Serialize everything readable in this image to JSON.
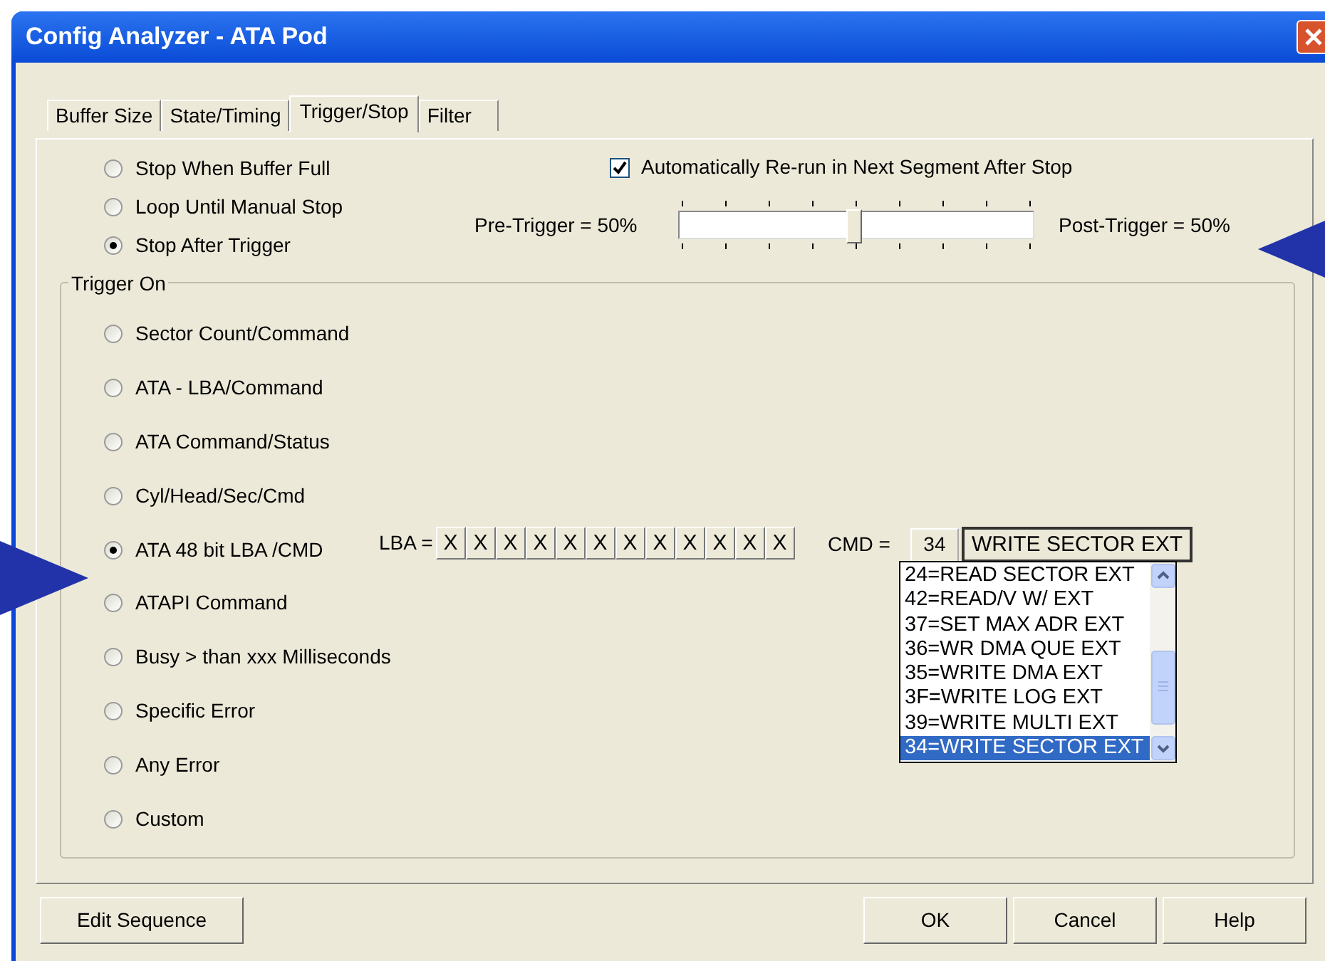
{
  "window": {
    "title": "Config Analyzer - ATA Pod"
  },
  "tabs": [
    {
      "label": "Buffer Size",
      "selected": false
    },
    {
      "label": "State/Timing",
      "selected": false
    },
    {
      "label": "Trigger/Stop",
      "selected": true
    },
    {
      "label": "Filter",
      "selected": false
    }
  ],
  "stop_modes": [
    {
      "label": "Stop When Buffer Full",
      "selected": false
    },
    {
      "label": "Loop Until Manual Stop",
      "selected": false
    },
    {
      "label": "Stop After Trigger",
      "selected": true
    }
  ],
  "auto_rerun": {
    "label": "Automatically Re-run in Next Segment After Stop",
    "checked": true
  },
  "trigger_slider": {
    "pre_label": "Pre-Trigger = 50%",
    "post_label": "Post-Trigger = 50%",
    "level": 0.5
  },
  "trigger_on": {
    "title": "Trigger On",
    "options": [
      {
        "label": "Sector Count/Command",
        "selected": false
      },
      {
        "label": "ATA - LBA/Command",
        "selected": false
      },
      {
        "label": "ATA Command/Status",
        "selected": false
      },
      {
        "label": "Cyl/Head/Sec/Cmd",
        "selected": false
      },
      {
        "label": "ATA 48 bit LBA /CMD",
        "selected": true
      },
      {
        "label": "ATAPI Command",
        "selected": false
      },
      {
        "label": "Busy > than  xxx Milliseconds",
        "selected": false
      },
      {
        "label": "Specific Error",
        "selected": false
      },
      {
        "label": "Any Error",
        "selected": false
      },
      {
        "label": "Custom",
        "selected": false
      }
    ]
  },
  "lba": {
    "label": "LBA =",
    "digits": [
      "X",
      "X",
      "X",
      "X",
      "X",
      "X",
      "X",
      "X",
      "X",
      "X",
      "X",
      "X"
    ]
  },
  "cmd": {
    "label": "CMD =",
    "code": "34",
    "value": "WRITE SECTOR EXT",
    "list": [
      {
        "label": "24=READ SECTOR EXT",
        "selected": false
      },
      {
        "label": "42=READ/V W/ EXT",
        "selected": false
      },
      {
        "label": "37=SET MAX ADR EXT",
        "selected": false
      },
      {
        "label": "36=WR DMA QUE EXT",
        "selected": false
      },
      {
        "label": "35=WRITE DMA EXT",
        "selected": false
      },
      {
        "label": "3F=WRITE LOG EXT",
        "selected": false
      },
      {
        "label": "39=WRITE MULTI EXT",
        "selected": false
      },
      {
        "label": "34=WRITE SECTOR EXT",
        "selected": true
      }
    ]
  },
  "buttons_left": [
    "Edit Sequence"
  ],
  "buttons_right": [
    "OK",
    "Cancel",
    "Help"
  ]
}
